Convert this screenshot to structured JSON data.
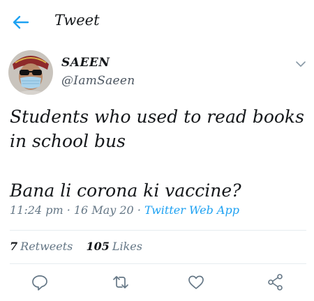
{
  "header": {
    "title": "Tweet",
    "back_icon": "back-arrow-icon"
  },
  "colors": {
    "accent": "#1da1f2",
    "secondary_text": "#657786",
    "text": "#14171a"
  },
  "author": {
    "name": "SAEEN",
    "handle": "@IamSaeen"
  },
  "tweet": {
    "line1": "Students who used to read books",
    "line2": "in school bus",
    "line3": "Bana li corona ki vaccine?"
  },
  "meta": {
    "time": "11:24 pm",
    "date": "16 May 20",
    "app": "Twitter Web App"
  },
  "stats": {
    "retweets_count": "7",
    "retweets_label": "Retweets",
    "likes_count": "105",
    "likes_label": "Likes"
  },
  "actions": [
    "reply-icon",
    "retweet-icon",
    "like-icon",
    "share-icon"
  ]
}
